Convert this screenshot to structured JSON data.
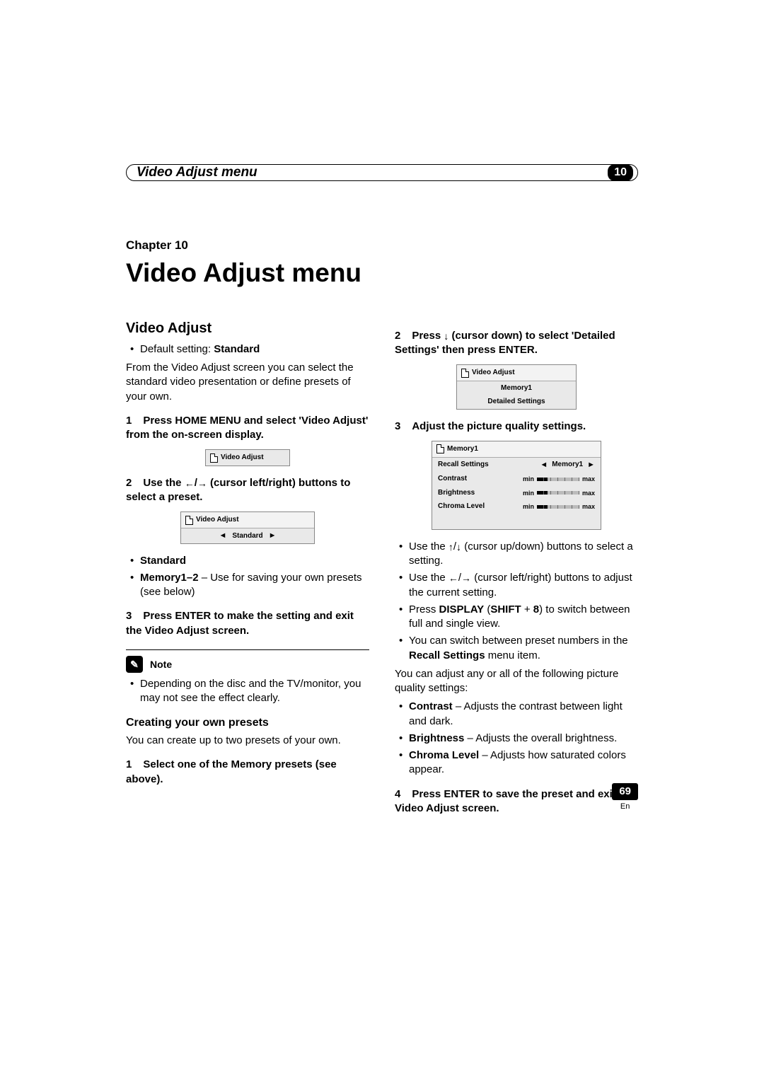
{
  "header": {
    "title": "Video Adjust menu",
    "chapter_number": "10"
  },
  "chapter": {
    "label": "Chapter 10",
    "title": "Video Adjust menu"
  },
  "left": {
    "section": "Video Adjust",
    "default_label": "Default setting: ",
    "default_value": "Standard",
    "intro": "From the Video Adjust screen you can select the standard video presentation or define presets of your own.",
    "step1": "Press HOME MENU and select 'Video Adjust' from the on-screen display.",
    "osd1_title": "Video Adjust",
    "step2_a": "Use the ",
    "step2_b": " (cursor left/right) buttons to select a preset.",
    "osd2_title": "Video Adjust",
    "osd2_value": "Standard",
    "bullet_standard": "Standard",
    "bullet_memory_label": "Memory1–2",
    "bullet_memory_desc": " – Use for saving your own presets (see below)",
    "step3": "Press ENTER to make the setting and exit the Video Adjust screen.",
    "note_label": "Note",
    "note_text": "Depending on the disc and the TV/monitor, you may not see the effect clearly.",
    "presets_heading": "Creating your own presets",
    "presets_intro": "You can create up to two presets of your own.",
    "presets_step1": "Select one of the Memory presets (see above)."
  },
  "right": {
    "step2_a": "Press ",
    "step2_b": " (cursor down) to select 'Detailed Settings' then press ENTER.",
    "osd3_title": "Video Adjust",
    "osd3_row1": "Memory1",
    "osd3_row2": "Detailed Settings",
    "step3": "Adjust the picture quality settings.",
    "osd4_title": "Memory1",
    "osd4_recall": "Recall Settings",
    "osd4_recall_val": "Memory1",
    "osd4_rows": [
      "Contrast",
      "Brightness",
      "Chroma Level"
    ],
    "osd4_min": "min",
    "osd4_max": "max",
    "tip1_a": "Use the ",
    "tip1_b": " (cursor up/down) buttons to select a setting.",
    "tip2_a": "Use the ",
    "tip2_b": " (cursor left/right) buttons to adjust the current setting.",
    "tip3_a": "Press ",
    "tip3_b": "DISPLAY",
    "tip3_c": " (",
    "tip3_d": "SHIFT",
    "tip3_e": " + ",
    "tip3_f": "8",
    "tip3_g": ") to switch between full and single view.",
    "tip4_a": "You can switch between preset numbers in the ",
    "tip4_b": "Recall Settings",
    "tip4_c": " menu item.",
    "adjust_intro": "You can adjust any or all of the following picture quality settings:",
    "adj1_label": "Contrast",
    "adj1_desc": " – Adjusts the contrast between light and dark.",
    "adj2_label": "Brightness",
    "adj2_desc": " – Adjusts the overall brightness.",
    "adj3_label": "Chroma Level",
    "adj3_desc": " – Adjusts how saturated colors appear.",
    "step4": "Press ENTER to save the preset and exit the Video Adjust screen."
  },
  "footer": {
    "page": "69",
    "lang": "En"
  }
}
